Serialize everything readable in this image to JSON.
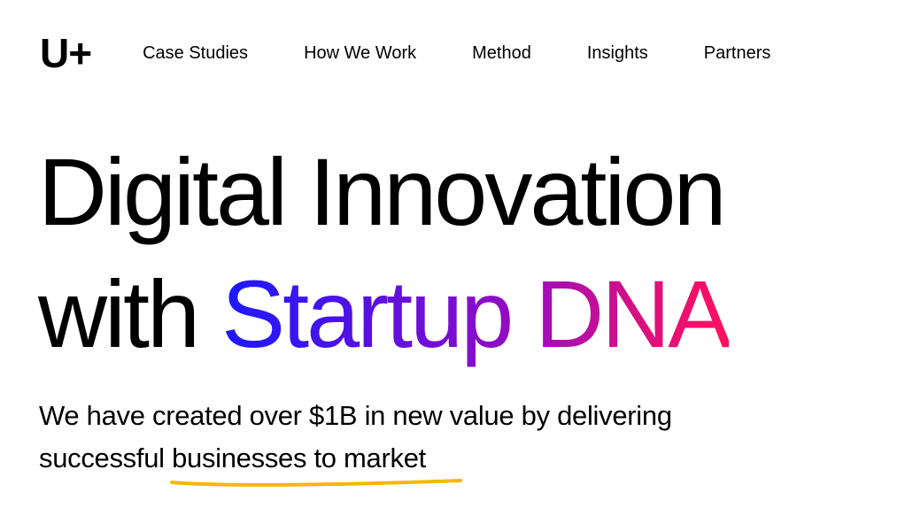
{
  "brand": {
    "logo_text": "U+"
  },
  "nav": {
    "items": [
      {
        "label": "Case Studies"
      },
      {
        "label": "How We Work"
      },
      {
        "label": "Method"
      },
      {
        "label": "Insights"
      },
      {
        "label": "Partners"
      }
    ]
  },
  "hero": {
    "headline_line1": "Digital Innovation",
    "headline_line2_prefix": "with",
    "headline_highlight": "Startup DNA",
    "subtitle_part1": "We have created over $1B in new value by delivering successful",
    "subtitle_underlined": "businesses to market"
  },
  "colors": {
    "background": "#ffffff",
    "text": "#000000",
    "gradient_start": "#1a1aff",
    "gradient_mid": "#9a0cc0",
    "gradient_end": "#ff1060",
    "underline_accent": "#f5b800"
  }
}
